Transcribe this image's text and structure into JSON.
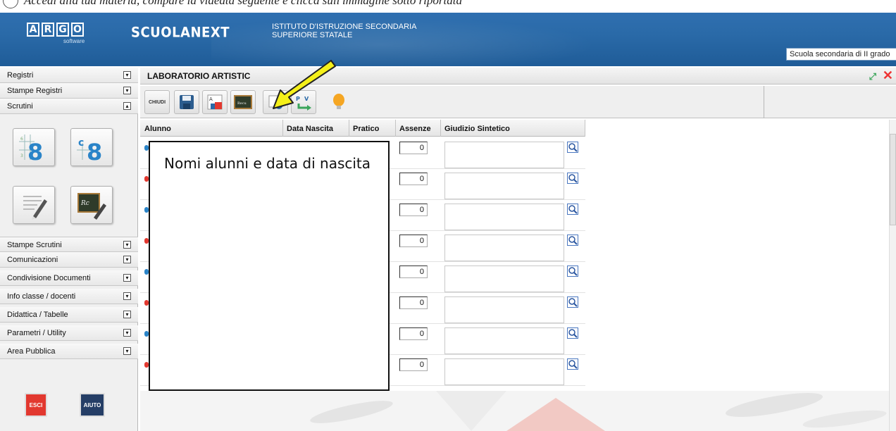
{
  "doc_caption": "Accedi alla tua materia, compare la videata seguente e clicca sull'immagine sotto riportata",
  "header": {
    "logo_letters": [
      "A",
      "R",
      "G",
      "O"
    ],
    "logo_sub": "software",
    "app_name": "SCUOLANEXT",
    "istituto_line1": "ISTITUTO D'ISTRUZIONE SECONDARIA",
    "istituto_line2": "SUPERIORE STATALE",
    "school_select": "Scuola secondaria di II grado"
  },
  "sidebar": {
    "top_items": [
      {
        "label": "Registri"
      },
      {
        "label": "Stampe Registri"
      },
      {
        "label": "Scrutini"
      }
    ],
    "bottom_items": [
      {
        "label": "Stampe Scrutini"
      },
      {
        "label": "Comunicazioni"
      },
      {
        "label": "Condivisione Documenti"
      },
      {
        "label": "Info classe / docenti"
      },
      {
        "label": "Didattica / Tabelle"
      },
      {
        "label": "Parametri / Utility"
      },
      {
        "label": "Area Pubblica"
      }
    ],
    "esci_label": "ESCI",
    "aiuto_label": "AIUTO"
  },
  "panel": {
    "title": "LABORATORIO ARTISTIC",
    "chiudi_label": "CHIUDI"
  },
  "grid": {
    "columns": [
      "Alunno",
      "Data Nascita",
      "Pratico",
      "Assenze",
      "Giudizio Sintetico"
    ],
    "rows": [
      {
        "assenze": "0"
      },
      {
        "assenze": "0"
      },
      {
        "assenze": "0"
      },
      {
        "assenze": "0"
      },
      {
        "assenze": "0"
      },
      {
        "assenze": "0"
      },
      {
        "assenze": "0"
      },
      {
        "assenze": "0"
      }
    ]
  },
  "callout": {
    "text": "Nomi alunni e data di nascita"
  },
  "colors": {
    "header_blue": "#2a6aa8",
    "arrow_yellow": "#f5f01a",
    "esci_red": "#e2382f",
    "aiuto_navy": "#253e66",
    "accent_blue": "#2a84c8"
  }
}
